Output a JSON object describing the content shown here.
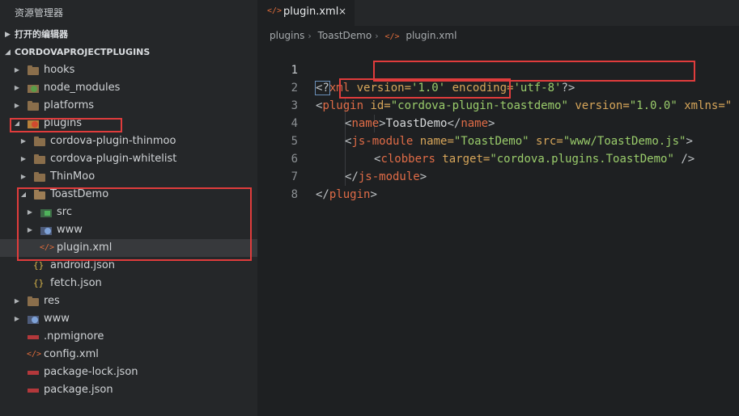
{
  "sidebar": {
    "title": "资源管理器",
    "open_editors_label": "打开的编辑器",
    "project_label": "CORDOVAPROJECTPLUGINS",
    "items": [
      {
        "label": "hooks"
      },
      {
        "label": "node_modules"
      },
      {
        "label": "platforms"
      },
      {
        "label": "plugins"
      },
      {
        "label": "cordova-plugin-thinmoo"
      },
      {
        "label": "cordova-plugin-whitelist"
      },
      {
        "label": "ThinMoo"
      },
      {
        "label": "ToastDemo"
      },
      {
        "label": "src"
      },
      {
        "label": "www"
      },
      {
        "label": "plugin.xml"
      },
      {
        "label": "android.json"
      },
      {
        "label": "fetch.json"
      },
      {
        "label": "res"
      },
      {
        "label": "www"
      },
      {
        "label": ".npmignore"
      },
      {
        "label": "config.xml"
      },
      {
        "label": "package-lock.json"
      },
      {
        "label": "package.json"
      }
    ]
  },
  "icons": {
    "xml_glyph": "</>",
    "json_glyph": "{}",
    "collapsed_glyph": "▶",
    "expanded_glyph": "◢",
    "close_glyph": "×",
    "breadcrumb_sep": "›"
  },
  "tab": {
    "label": "plugin.xml"
  },
  "breadcrumb": [
    "plugins",
    "ToastDemo",
    "plugin.xml"
  ],
  "code": {
    "line_numbers": [
      "1",
      "2",
      "3",
      "4",
      "5",
      "6",
      "7",
      "8"
    ],
    "l1": {
      "open": "<?",
      "name": "xml",
      "a1": " version=",
      "v1": "'1.0'",
      "a2": " encoding=",
      "v2": "'utf-8'",
      "close": "?>"
    },
    "l2": {
      "lt": "<",
      "tag": "plugin",
      "a1": " id=",
      "v1": "\"cordova-plugin-toastdemo\"",
      "a2": " version=",
      "v2": "\"1.0.0\"",
      "a3": " xmlns=\""
    },
    "l3": {
      "lt1": "<",
      "tag1": "name",
      "gt1": ">",
      "text": "ToastDemo",
      "lt2": "</",
      "tag2": "name",
      "gt2": ">"
    },
    "l4": {
      "lt": "<",
      "tag": "js-module",
      "a1": " name=",
      "v1": "\"ToastDemo\"",
      "a2": " src=",
      "v2": "\"www/ToastDemo.js\"",
      "gt": ">"
    },
    "l5": {
      "lt": "<",
      "tag": "clobbers",
      "a1": " target=",
      "v1": "\"cordova.plugins.ToastDemo\"",
      "end": " />"
    },
    "l6": {
      "lt": "</",
      "tag": "js-module",
      "gt": ">"
    },
    "l7": {
      "lt": "</",
      "tag": "plugin",
      "gt": ">"
    }
  },
  "colors": {
    "highlight_box": "#e03c3c",
    "tag": "#e06c47",
    "attribute": "#d7a65a",
    "string": "#9acc6b"
  }
}
